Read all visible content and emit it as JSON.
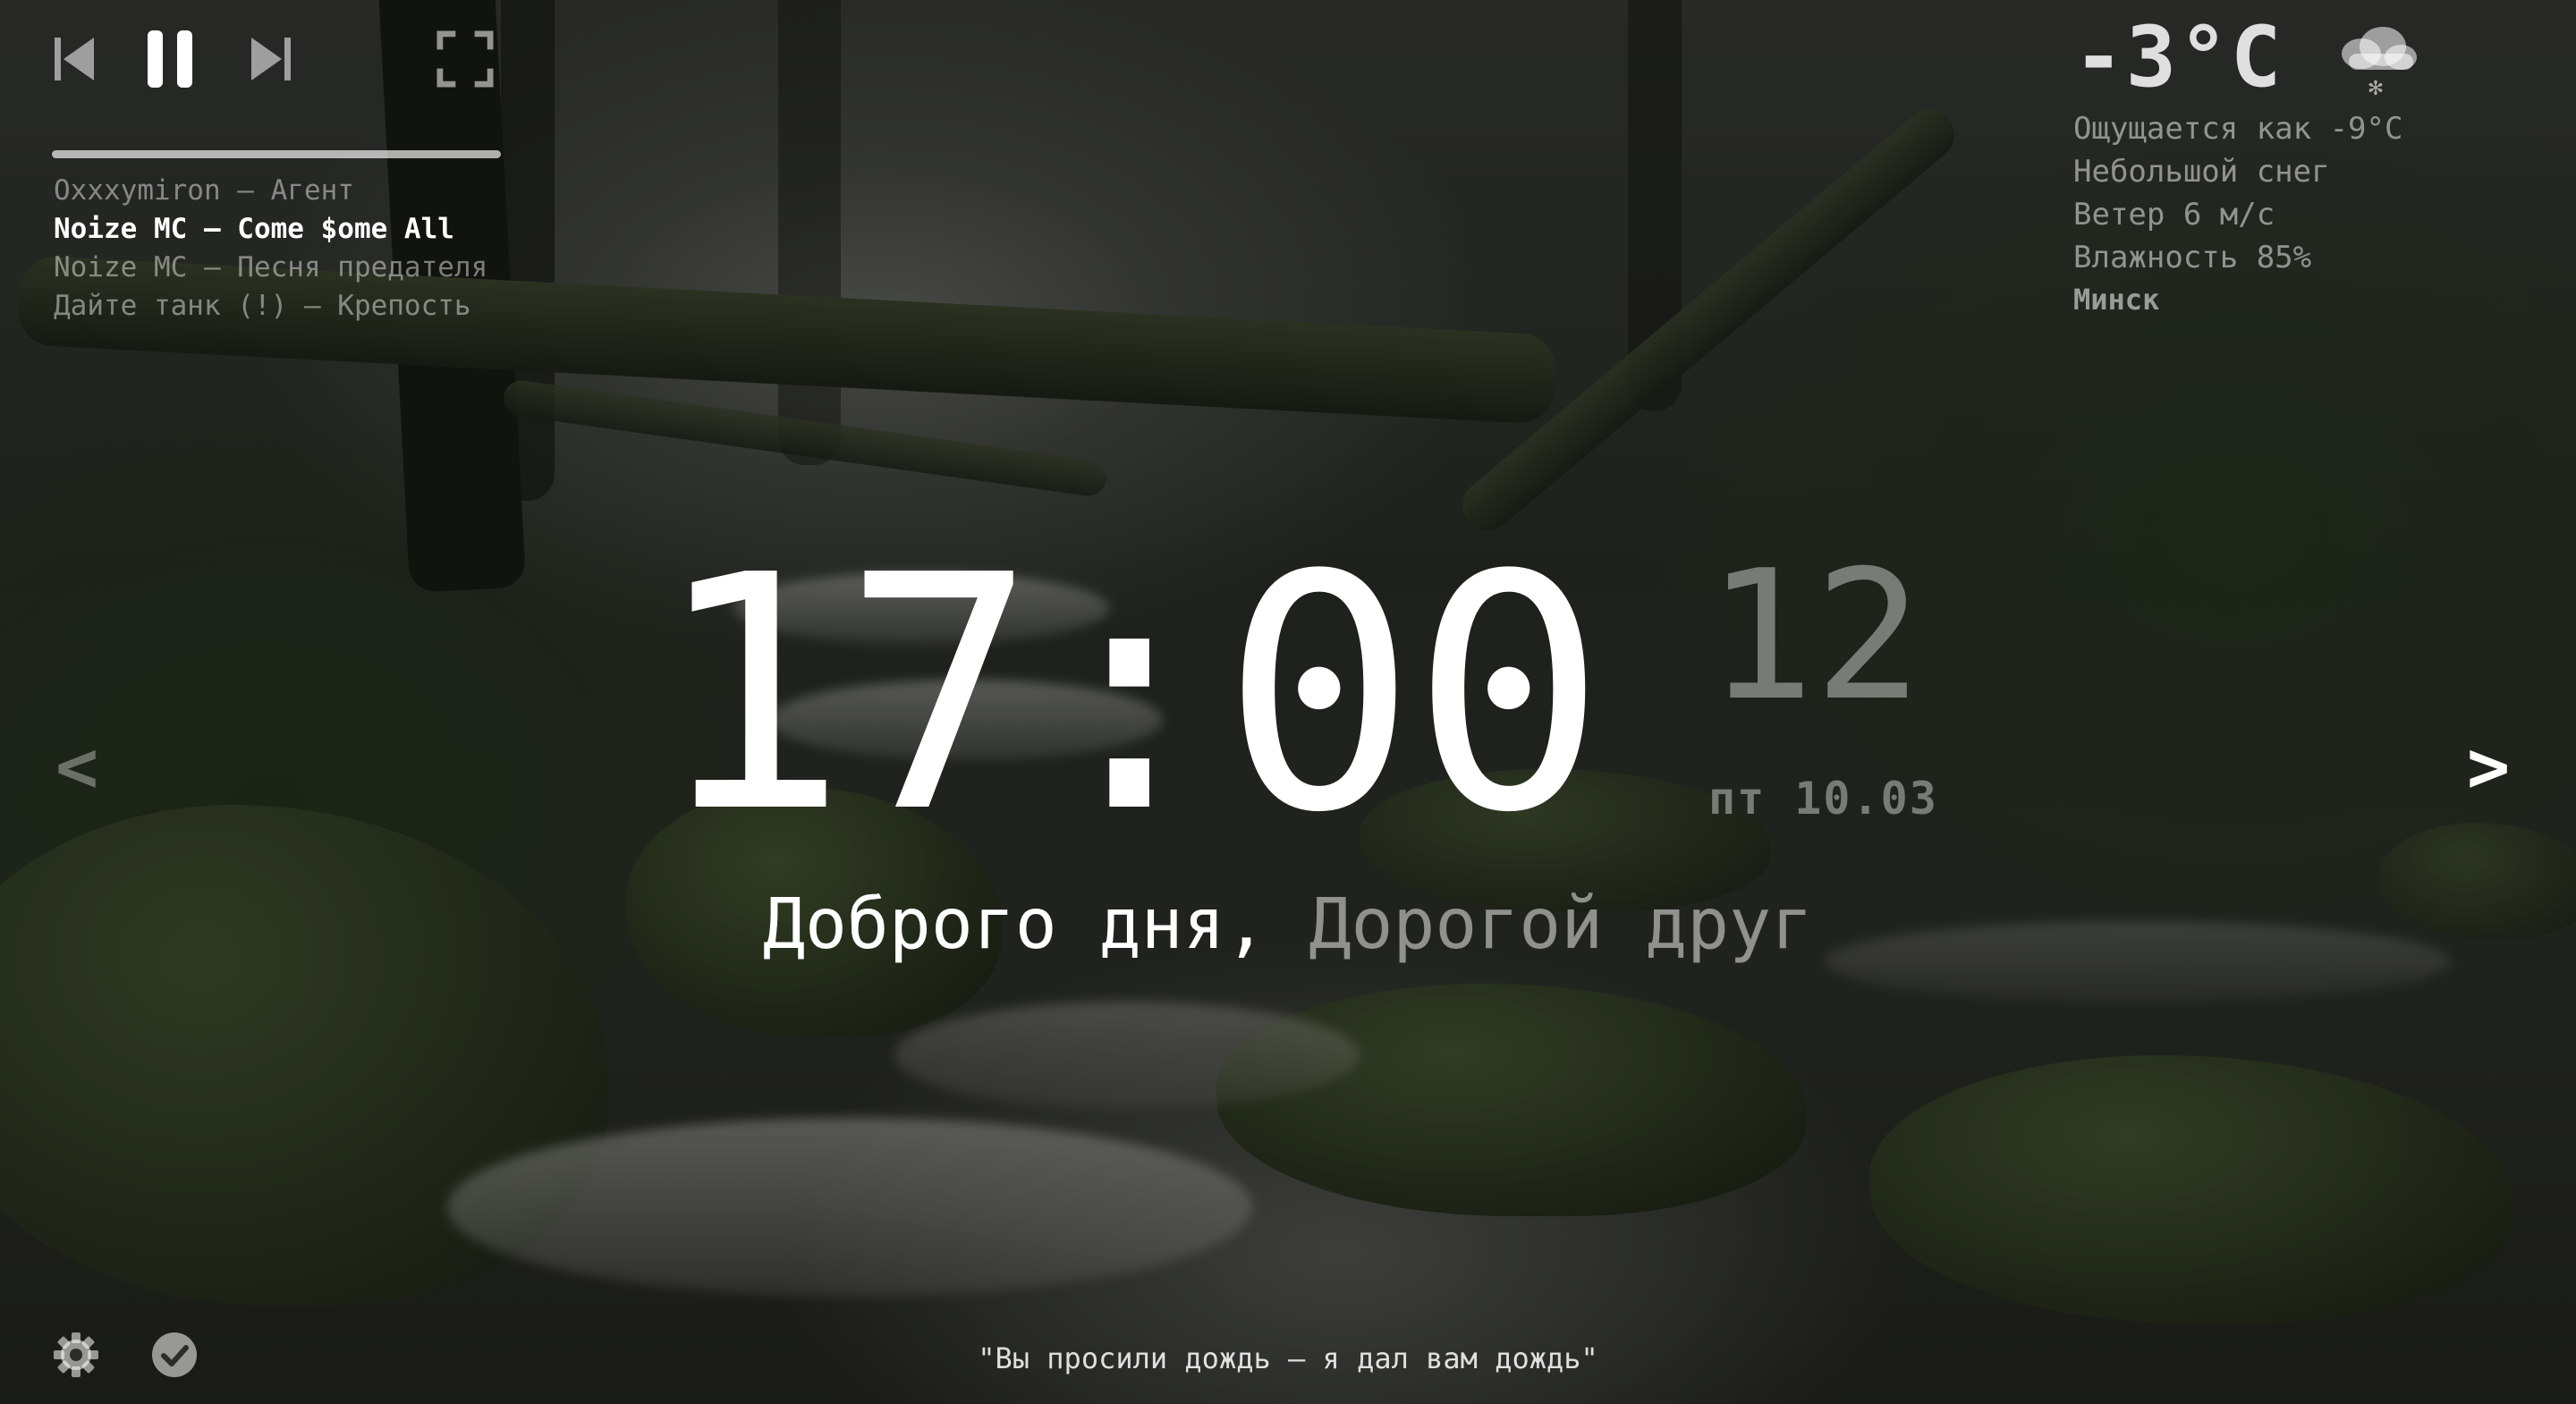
{
  "player": {
    "icons": {
      "prev": "skip-previous-icon",
      "pause": "pause-icon",
      "next": "skip-next-icon",
      "fullscreen": "fullscreen-icon"
    },
    "progress": 1.0,
    "tracks": [
      "Oxxxymiron — Агент",
      "Noize MC — Come $ome All",
      "Noize MC — Песня предателя",
      "Дайте танк (!) — Крепость"
    ],
    "active_track_index": 1
  },
  "weather": {
    "temperature": "-3°C",
    "icon": "snow-cloud-icon",
    "feels_like": "Ощущается как -9°C",
    "condition": "Небольшой снег",
    "wind": "Ветер 6 м/с",
    "humidity": "Влажность 85%",
    "city": "Минск"
  },
  "clock": {
    "time": "17:00",
    "seconds": "12",
    "date": "пт 10.03"
  },
  "greeting": {
    "hello": "Доброго дня,",
    "name": "Дорогой друг"
  },
  "navigation": {
    "prev": "<",
    "next": ">"
  },
  "quote": "\"Вы просили дождь — я дал вам дождь\"",
  "bottom_icons": {
    "settings": "gear-icon",
    "todo": "check-circle-icon"
  }
}
